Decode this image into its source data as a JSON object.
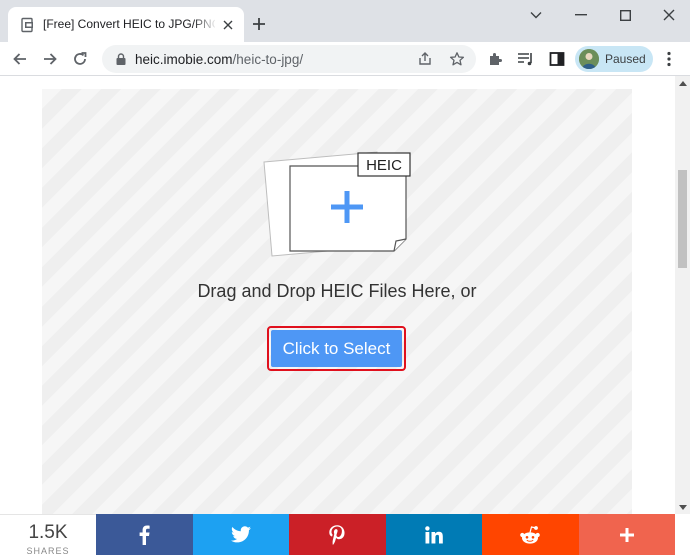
{
  "browser": {
    "tab": {
      "title": "[Free] Convert HEIC to JPG/PNG/..."
    },
    "address_bar": {
      "domain": "heic.imobie.com",
      "path": "/heic-to-jpg/"
    },
    "profile": {
      "label": "Paused"
    }
  },
  "upload": {
    "file_badge": "HEIC",
    "drop_text": "Drag and Drop HEIC Files Here, or",
    "select_button": "Click to Select"
  },
  "share": {
    "count": "1.5K",
    "count_label": "SHARES",
    "buttons": [
      {
        "network": "facebook",
        "icon": "facebook-icon",
        "color": "#3b5998"
      },
      {
        "network": "twitter",
        "icon": "twitter-icon",
        "color": "#1da1f2"
      },
      {
        "network": "pinterest",
        "icon": "pinterest-icon",
        "color": "#cb2027"
      },
      {
        "network": "linkedin",
        "icon": "linkedin-icon",
        "color": "#007bb5"
      },
      {
        "network": "reddit",
        "icon": "reddit-icon",
        "color": "#ff4500"
      },
      {
        "network": "more",
        "icon": "plus-icon",
        "color": "#f0644e"
      }
    ]
  },
  "colors": {
    "select_button_bg": "#4e97f5",
    "select_button_highlight": "#e0101d",
    "plus_icon": "#4e97f5"
  }
}
